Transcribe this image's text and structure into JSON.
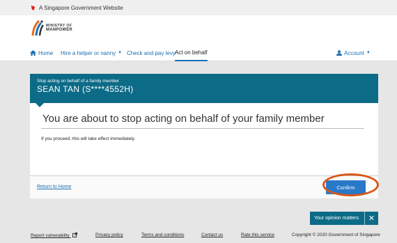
{
  "gov_bar": {
    "text": "A Singapore Government Website"
  },
  "logo": {
    "line1": "MINISTRY OF",
    "line2": "MANPOWER"
  },
  "nav": {
    "home": "Home",
    "hire": "Hire a helper or nanny",
    "check": "Check and pay levy",
    "act": "Act on behalf",
    "account": "Account"
  },
  "card": {
    "subtitle": "Stop acting on behalf of a family member",
    "name": "SEAN TAN (S****4552H)",
    "title": "You are about to stop acting on behalf of your family member",
    "body": "If you proceed, this will take effect immediately.",
    "return_link": "Return to Home",
    "confirm_label": "Confirm"
  },
  "feedback": {
    "label": "Your opinion matters",
    "close": "✕"
  },
  "footer": {
    "links": [
      "Report vulnerability",
      "Privacy policy",
      "Terms and conditions",
      "Contact us",
      "Rate this service"
    ],
    "copyright": "Copyright © 2020 Government of Singapore"
  },
  "colors": {
    "brand": "#0c6b86",
    "link": "#1c6fb3",
    "button": "#2a78c8",
    "highlight": "#d95718"
  }
}
